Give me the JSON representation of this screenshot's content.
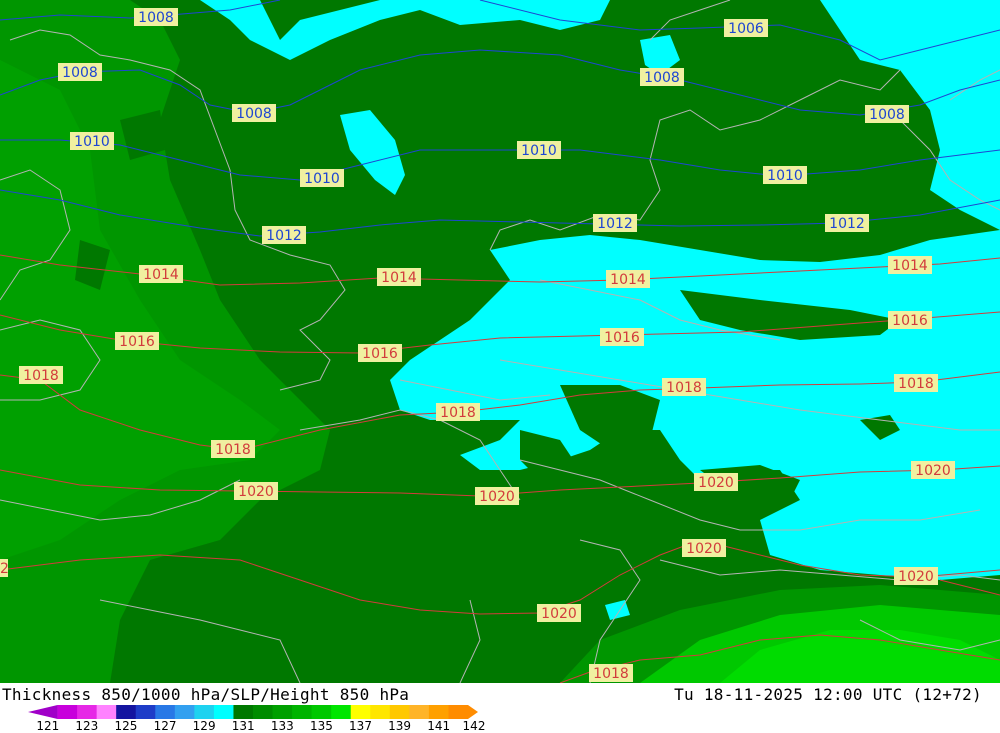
{
  "map": {
    "title_left": "Thickness 850/1000 hPa/SLP/Height 850 hPa",
    "title_right": "Tu 18-11-2025 12:00 UTC (12+72)",
    "colors": {
      "dark_green": "#007800",
      "mid_green": "#009600",
      "light_green": "#00c800",
      "bright_green": "#00dc00",
      "cyan": "#00ffff",
      "coast": "#b4b4b4",
      "isobar_blue": "#1e46d2",
      "isobar_red": "#d23c3c",
      "label_bg": "#f0f0a0"
    },
    "isobars": [
      {
        "value": "1006",
        "color": "blue",
        "labels": [
          {
            "text": "1006"
          }
        ]
      },
      {
        "value": "1008",
        "color": "blue",
        "labels": [
          {
            "text": "1008"
          },
          {
            "text": "1008"
          },
          {
            "text": "1008"
          },
          {
            "text": "1008"
          },
          {
            "text": "1008"
          }
        ]
      },
      {
        "value": "1010",
        "color": "blue",
        "labels": [
          {
            "text": "1010"
          },
          {
            "text": "1010"
          },
          {
            "text": "1010"
          },
          {
            "text": "1010"
          }
        ]
      },
      {
        "value": "1012",
        "color": "blue",
        "labels": [
          {
            "text": "1012"
          },
          {
            "text": "1012"
          },
          {
            "text": "1012"
          }
        ]
      },
      {
        "value": "1014",
        "color": "red",
        "labels": [
          {
            "text": "1014"
          },
          {
            "text": "1014"
          },
          {
            "text": "1014"
          },
          {
            "text": "1014"
          }
        ]
      },
      {
        "value": "1016",
        "color": "red",
        "labels": [
          {
            "text": "1016"
          },
          {
            "text": "1016"
          },
          {
            "text": "1016"
          },
          {
            "text": "1016"
          }
        ]
      },
      {
        "value": "1018",
        "color": "red",
        "labels": [
          {
            "text": "1018"
          },
          {
            "text": "1018"
          },
          {
            "text": "1018"
          },
          {
            "text": "1018"
          },
          {
            "text": "1018"
          },
          {
            "text": "1018"
          }
        ]
      },
      {
        "value": "1020",
        "color": "red",
        "labels": [
          {
            "text": "1020"
          },
          {
            "text": "1020"
          },
          {
            "text": "1020"
          },
          {
            "text": "1020"
          },
          {
            "text": "1020"
          },
          {
            "text": "1020"
          },
          {
            "text": "1020"
          }
        ]
      },
      {
        "value": "1018",
        "color": "red",
        "labels": [
          {
            "text": "1018"
          }
        ]
      }
    ],
    "edge_label": "2",
    "colorbar": {
      "ticks": [
        "121",
        "123",
        "125",
        "127",
        "129",
        "131",
        "133",
        "135",
        "137",
        "139",
        "141",
        "142"
      ],
      "segments": [
        "#a000c8",
        "#c800dc",
        "#e628e6",
        "#ff82ff",
        "#1414a0",
        "#1e3cc8",
        "#2878e6",
        "#32a0f0",
        "#1ed2f0",
        "#00ffff",
        "#007800",
        "#008c00",
        "#00a000",
        "#00b400",
        "#00c800",
        "#00e600",
        "#ffff00",
        "#ffe600",
        "#ffc800",
        "#ffb428",
        "#ffa000",
        "#ff8c00"
      ]
    }
  }
}
